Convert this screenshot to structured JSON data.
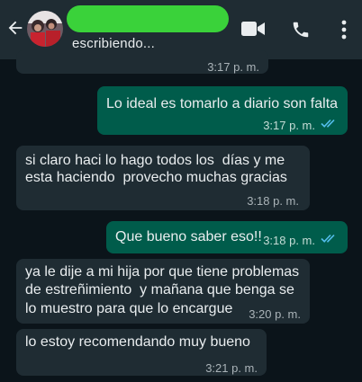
{
  "header": {
    "status": "escribiendo...",
    "icons": [
      "back-arrow-icon",
      "video-call-icon",
      "voice-call-icon",
      "more-options-icon"
    ]
  },
  "messages": [
    {
      "direction": "in",
      "text": "",
      "time": "3:17 p. m."
    },
    {
      "direction": "out",
      "text": "Lo ideal es tomarlo a diario son falta",
      "time": "3:17 p. m.",
      "read": true
    },
    {
      "direction": "in",
      "lines": [
        "si claro haci lo hago todos los  días y me",
        "esta haciendo  provecho muchas gracias"
      ],
      "time": "3:18 p. m."
    },
    {
      "direction": "out",
      "text": "Que bueno saber eso!!",
      "time": "3:18 p. m.",
      "read": true
    },
    {
      "direction": "in",
      "lines": [
        "ya le dije a mi hija por que tiene problemas",
        "de estreñimiento  y mañana que benga se",
        "lo muestro para que lo encargue"
      ],
      "time": "3:20 p. m."
    },
    {
      "direction": "in",
      "text": "lo estoy recomendando muy bueno",
      "time": "3:21 p. m."
    }
  ],
  "colors": {
    "background": "#0b141a",
    "header": "#1f2c33",
    "incoming": "#1f2c33",
    "outgoing": "#005c4b",
    "read_ticks": "#53bdeb",
    "redaction": "#3ad23a"
  }
}
